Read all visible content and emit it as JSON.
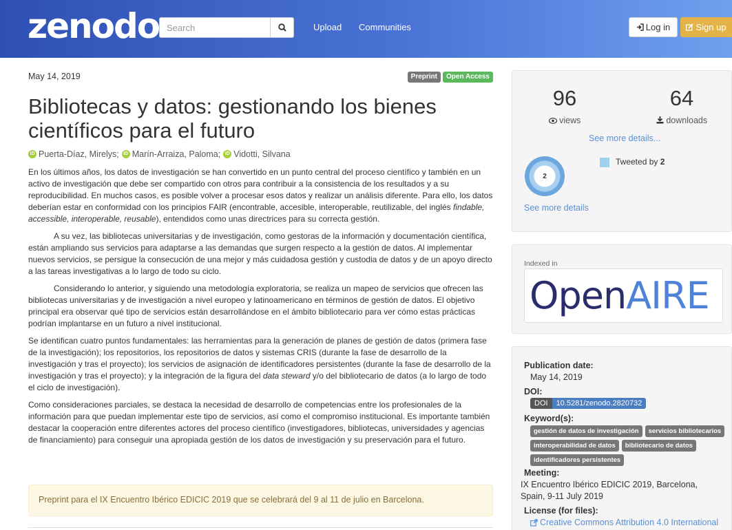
{
  "header": {
    "logo_text": "zenodo",
    "search_placeholder": "Search",
    "nav_upload": "Upload",
    "nav_communities": "Communities",
    "login_label": "Log in",
    "signup_label": "Sign up"
  },
  "record": {
    "date": "May 14, 2019",
    "badges": [
      "Preprint",
      "Open Access"
    ],
    "title": "Bibliotecas y datos: gestionando los bienes científicos para el futuro",
    "creators": [
      "Puerta-Díaz, Mirelys;",
      "Marín-Arraiza, Paloma;",
      "Vidotti, Silvana"
    ],
    "description": {
      "p1_a": "En los últimos años, los datos de investigación se han convertido en un punto central del proceso científico y también en un activo de investigación que debe ser compartido con otros para contribuir a la consistencia de los resultados y a su reproducibilidad. En muchos casos, es posible volver a procesar esos datos y realizar un análisis diferente. Para ello, los datos deberían estar en conformidad con los principios FAIR (encontrable, accesible, interoperable, reutilizable, del inglés ",
      "p1_em": "findable, accessible, interoperable, reusable",
      "p1_b": "), entendidos como unas directrices para su correcta gestión.",
      "p2": "A su vez, las bibliotecas universitarias y de investigación, como gestoras de la información y documentación científica, están ampliando sus servicios para adaptarse a las demandas que surgen respecto a la gestión de datos. Al implementar nuevos servicios, se persigue la consecución de una mejor y más cuidadosa gestión y custodia de datos y de un apoyo directo a las tareas investigativas a lo largo de todo su ciclo.",
      "p3": "Considerando lo anterior, y siguiendo una metodología exploratoria, se realiza un mapeo de servicios que ofrecen las bibliotecas universitarias y de investigación a nivel europeo y latinoamericano en términos de gestión de datos. El objetivo principal era observar qué tipo de servicios están desarrollándose en el ámbito bibliotecario para ver cómo estas prácticas podrían implantarse en un futuro a nivel institucional.",
      "p4_a": "Se identifican cuatro puntos fundamentales: las herramientas para la generación de planes de gestión de datos (primera fase de la investigación); los repositorios, los repositorios de datos y sistemas CRIS (durante la fase de desarrollo de la investigación y tras el proyecto); los servicios de asignación de identificadores persistentes (durante la fase de desarrollo de la investigación y tras el proyecto); y la integración de la figura del ",
      "p4_em": "data steward",
      "p4_b": " y/o del bibliotecario de datos (a lo largo de todo el ciclo de investigación).",
      "p5": "Como consideraciones parciales, se destaca la necesidad de desarrollo de competencias entre los profesionales de la información para que puedan implementar este tipo de servicios, así como el compromiso institucional. Es importante también destacar la cooperación entre diferentes actores del proceso científico (investigadores, bibliotecas, universidades y agencias de financiamiento) para conseguir una apropiada gestión de los datos de investigación y su preservación para el futuro."
    },
    "notes": "Preprint para el IX Encuentro Ibérico EDICIC 2019 que se celebrará del 9 al 11 de julio en Barcelona."
  },
  "stats": {
    "views": "96",
    "views_label": "views",
    "downloads": "64",
    "downloads_label": "downloads",
    "see_more_details_1": "See more details...",
    "altmetric_score": "2",
    "tweeted_by_label": "Tweeted by",
    "tweeted_by_count": "2",
    "see_more_details_2": "See more details"
  },
  "openaire": {
    "indexed_label": "Indexed in",
    "logo_open": "Open",
    "logo_aire": "AIRE"
  },
  "metadata": {
    "pub_date_label": "Publication date:",
    "pub_date": "May 14, 2019",
    "doi_label": "DOI:",
    "doi_prefix": "DOI",
    "doi_value": "10.5281/zenodo.2820732",
    "keywords_label": "Keyword(s):",
    "keywords": [
      "gestión de datos de investigación",
      "servicios bibliotecarios",
      "interoperabilidad de datos",
      "bibliotecario de datos",
      "identificadores persistentes"
    ],
    "meeting_label": "Meeting:",
    "meeting_value": "IX Encuentro Ibérico EDICIC 2019, Barcelona, Spain, 9-11 July 2019",
    "license_label": "License (for files):",
    "license_value": "Creative Commons Attribution 4.0 International"
  },
  "colors": {
    "header_start": "#2f4fb3",
    "header_end": "#6fa0ee",
    "link": "#5b8fd6",
    "signup": "#e3b348",
    "open_access": "#5cb85c",
    "orcid": "#a6ce39"
  }
}
